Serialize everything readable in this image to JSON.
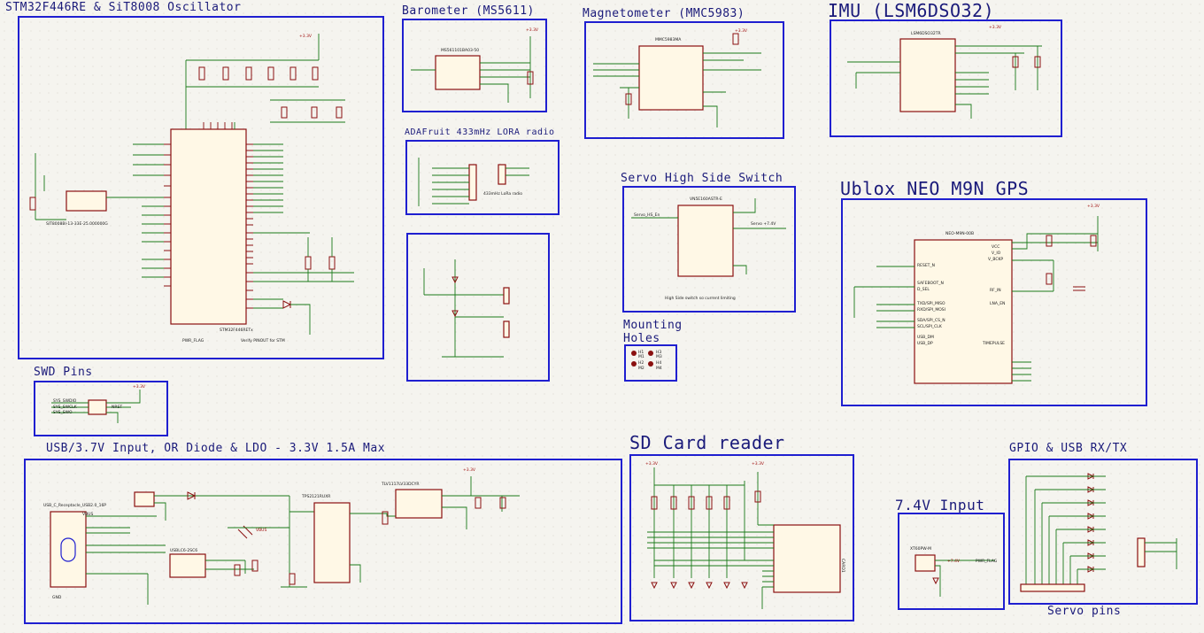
{
  "blocks": {
    "mcu": "STM32F446RE & SiT8008 Oscillator",
    "baro": "Barometer (MS5611)",
    "mag": "Magnetometer (MMC5983)",
    "imu": "IMU (LSM6DSO32)",
    "lora": "ADAFruit 433mHz LORA radio",
    "servo_switch": "Servo High Side Switch",
    "gps": "Ublox NEO M9N GPS",
    "mounting": "Mounting Holes",
    "swd": "SWD Pins",
    "power": "USB/3.7V Input, OR Diode & LDO - 3.3V 1.5A Max",
    "sd": "SD Card reader",
    "input74": "7.4V Input",
    "gpio": "GPIO & USB RX/TX",
    "servo_pins": "Servo pins"
  },
  "parts": {
    "mcu_chip": "STM32F446RETx",
    "osc": "SIT8008BI-13-33E-25.000000G",
    "baro_chip": "MS561101BA03-50",
    "mag_chip": "MMC5983MA",
    "imu_chip": "LSM6DSO32TR",
    "servo_ic": "VN5E160ASTR-E",
    "gps_chip": "NEO-M9N-00B",
    "ldo": "TLV1117LV33DCYR",
    "usb": "USB_C_Receptacle_USB2.0_16P",
    "mosfet": "TPS2121RUXR",
    "esd": "USBLC6-2SC6",
    "sd_conn": "CARD1",
    "xt60": "XT60PW-M"
  },
  "nets": {
    "v33": "+3.3V",
    "v74": "+7.4V",
    "vbus": "VBUS",
    "gnd": "GND",
    "pwr_flag": "PWR_FLAG",
    "servo_hs": "Servo_HS_En",
    "servo_74": "Servo +7.4V"
  },
  "notes": {
    "mcu_note": "Verify PINOUT for STM",
    "servo_note": "High Side switch so current limiting",
    "lora_note": "433mHz LoRa radio"
  },
  "mounting_labels": [
    "H1",
    "H2",
    "H3",
    "H4",
    "M1",
    "M2",
    "M3",
    "M4"
  ],
  "swd_labels": [
    "SYS_SWDIO",
    "SYS_SWCLK",
    "SYS_SWO",
    "NRST"
  ],
  "gps_pins": [
    "RESET_N",
    "SAFEBOOT_N",
    "D_SEL",
    "TXD/SPI_MISO",
    "RXD/SPI_MOSI",
    "SDA/SPI_CS_N",
    "SCL/SPI_CLK",
    "USB_DM",
    "USB_DP",
    "VCC",
    "V_IO",
    "V_BCKP",
    "RF_IN",
    "LNA_EN",
    "TIMEPULSE"
  ]
}
